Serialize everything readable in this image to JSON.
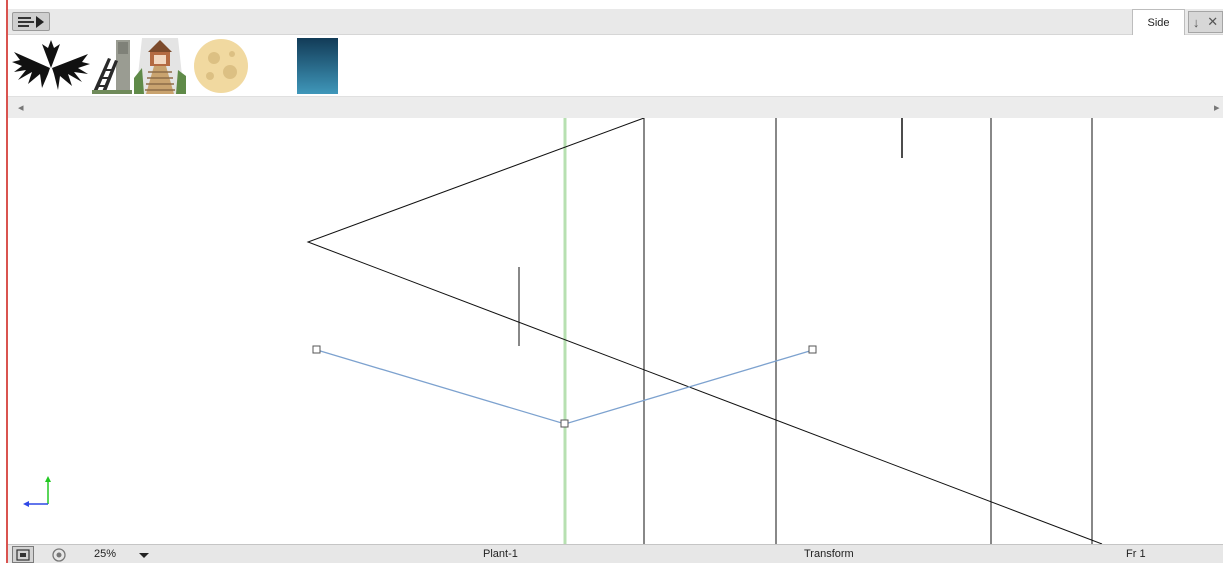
{
  "toolbar": {
    "menu_icon": "menu-play-icon",
    "view_tab_label": "Side",
    "tab_tool_icons": [
      "arrow-down-icon",
      "close-icon"
    ]
  },
  "thumbnails": [
    {
      "name": "palm-tree-icon"
    },
    {
      "name": "ladder-tower-icon"
    },
    {
      "name": "gazebo-bridge-icon"
    },
    {
      "name": "moon-icon"
    },
    {
      "name": "gradient-panel-icon"
    }
  ],
  "status": {
    "zoom": "25%",
    "layer_name": "Plant-1",
    "mode": "Transform",
    "frame": "Fr 1"
  },
  "colors": {
    "canvas_bg": "#ffffff",
    "line": "#000000",
    "guide": "#b7e0b1",
    "spline": "#7da2cf",
    "axis_y": "#22c922",
    "axis_x": "#2f48e6",
    "left_border": "#d9534f"
  }
}
